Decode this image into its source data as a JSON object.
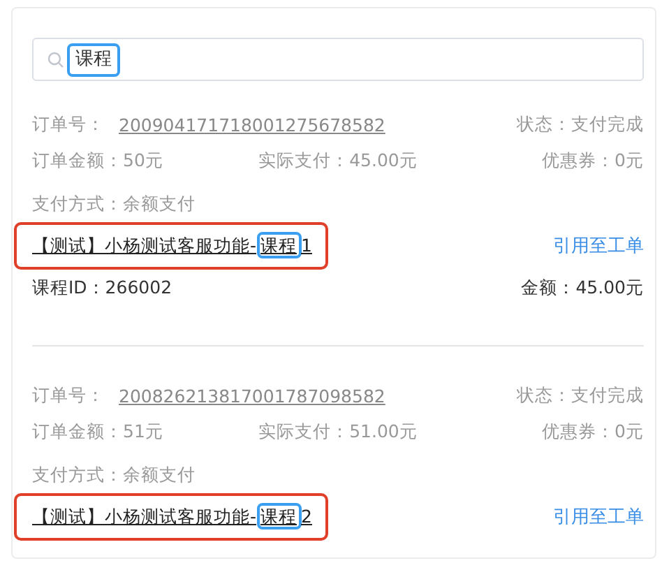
{
  "search": {
    "value": "课程",
    "highlighted": true
  },
  "orders": [
    {
      "order_label": "订单号：",
      "order_number": "200904171718001275678582",
      "status": "状态：支付完成",
      "order_amount": "订单金额：50元",
      "actual_paid": "实际支付：45.00元",
      "coupon": "优惠券：0元",
      "payment_method": "支付方式：余额支付",
      "title": {
        "before": "【测试】小杨测试客服功能-",
        "match": "课程",
        "after": "1"
      },
      "highlighted": true,
      "action": "引用至工单",
      "course_id": "课程ID：266002",
      "amount": "金额：45.00元"
    },
    {
      "order_label": "订单号：",
      "order_number": "200826213817001787098582",
      "status": "状态：支付完成",
      "order_amount": "订单金额：51元",
      "actual_paid": "实际支付：51.00元",
      "coupon": "优惠券：0元",
      "payment_method": "支付方式：余额支付",
      "title": {
        "before": "【测试】小杨测试客服功能-",
        "match": "课程",
        "after": "2"
      },
      "highlighted": true,
      "action": "引用至工单"
    }
  ]
}
